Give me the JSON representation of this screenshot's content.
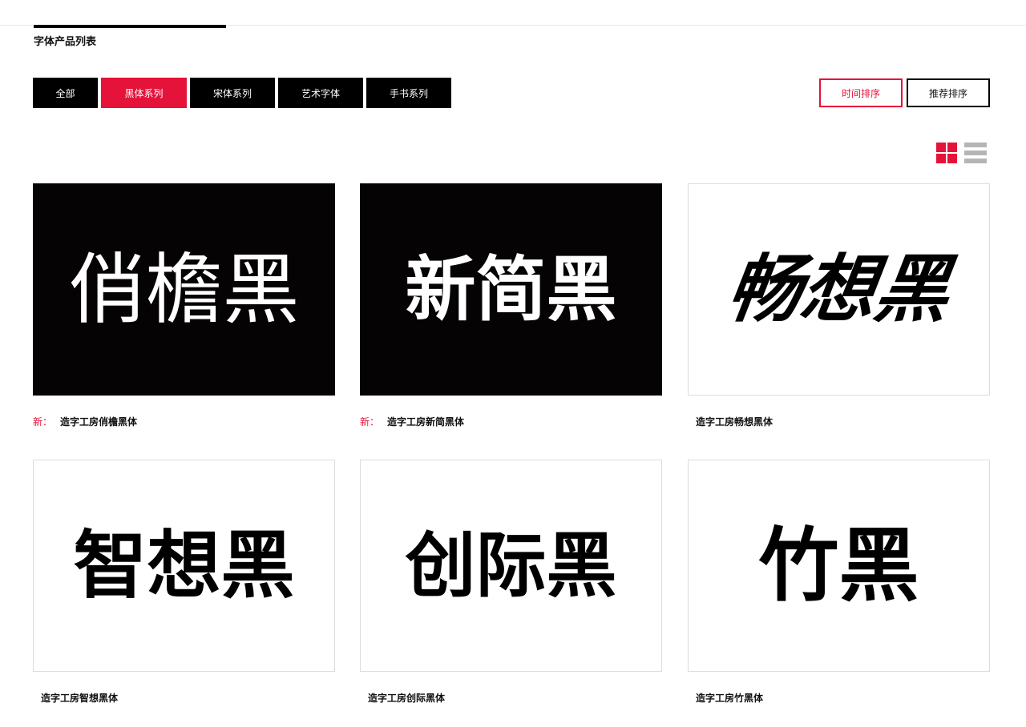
{
  "section": {
    "title": "字体产品列表"
  },
  "filters": [
    {
      "label": "全部",
      "active": false
    },
    {
      "label": "黑体系列",
      "active": true
    },
    {
      "label": "宋体系列",
      "active": false
    },
    {
      "label": "艺术字体",
      "active": false
    },
    {
      "label": "手书系列",
      "active": false
    }
  ],
  "sort": [
    {
      "label": "时间排序",
      "active": true
    },
    {
      "label": "推荐排序",
      "active": false
    }
  ],
  "view": {
    "grid_icon": "grid-view-icon",
    "list_icon": "list-view-icon",
    "active_color": "#e5133a",
    "inactive_color": "#b5b5b5"
  },
  "colors": {
    "accent": "#e5133a",
    "dark": "#000000"
  },
  "products": [
    {
      "preview": "俏檐黑",
      "name": "造字工房俏檐黑体",
      "new_label": "新：",
      "theme": "dark"
    },
    {
      "preview": "新简黑",
      "name": "造字工房新简黑体",
      "new_label": "新：",
      "theme": "dark"
    },
    {
      "preview": "畅想黑",
      "name": "造字工房畅想黑体",
      "new_label": "",
      "theme": "light"
    },
    {
      "preview": "智想黑",
      "name": "造字工房智想黑体",
      "new_label": "",
      "theme": "light"
    },
    {
      "preview": "创际黑",
      "name": "造字工房创际黑体",
      "new_label": "",
      "theme": "light"
    },
    {
      "preview": "竹黑",
      "name": "造字工房竹黑体",
      "new_label": "",
      "theme": "light"
    }
  ]
}
